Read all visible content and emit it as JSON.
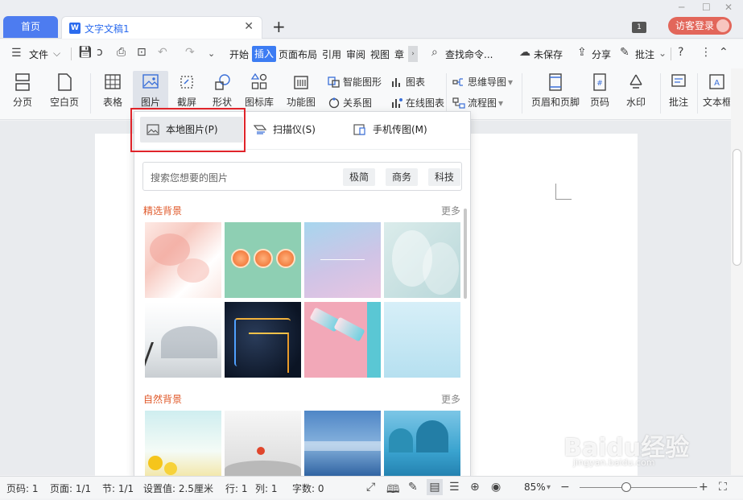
{
  "titlebar": {
    "home_tab": "首页",
    "doc_tab": "文字文稿1",
    "doc_icon": "W",
    "page_count_badge": "1",
    "login_label": "访客登录"
  },
  "menu": {
    "file": "文件",
    "items": [
      "开始",
      "插入",
      "页面布局",
      "引用",
      "审阅",
      "视图",
      "章"
    ],
    "search": "查找命令...",
    "unsaved": "未保存",
    "share": "分享",
    "comment": "批注"
  },
  "ribbon": {
    "page_break": "分页",
    "blank_page": "空白页",
    "table": "表格",
    "picture": "图片",
    "screenshot": "截屏",
    "shape": "形状",
    "icon_lib": "图标库",
    "func_chart": "功能图",
    "smart_graphic": "智能图形",
    "chart": "图表",
    "mind_map": "思维导图",
    "relation": "关系图",
    "online_chart": "在线图表",
    "flowchart": "流程图",
    "header_footer": "页眉和页脚",
    "page_number": "页码",
    "watermark": "水印",
    "annotate": "批注",
    "textbox": "文本框"
  },
  "panel": {
    "local_picture": "本地图片(P)",
    "scanner": "扫描仪(S)",
    "phone_upload": "手机传图(M)",
    "search_placeholder": "搜索您想要的图片",
    "tags": [
      "极简",
      "商务",
      "科技"
    ],
    "section1": "精选背景",
    "section2": "自然背景",
    "more": "更多"
  },
  "status": {
    "page": "页码: 1",
    "pages": "页面: 1/1",
    "section": "节: 1/1",
    "setting": "设置值: 2.5厘米",
    "row": "行: 1",
    "col": "列: 1",
    "words": "字数: 0",
    "zoom": "85%"
  },
  "watermark": {
    "brand": "Baidu经验",
    "url": "jingyan.baidu.com"
  },
  "colors": {
    "accent": "#3c7cf3",
    "home_tab": "#4d7cf0",
    "login": "#e2665a",
    "highlight_box": "#e0242a",
    "section_title": "#e05a2b"
  }
}
